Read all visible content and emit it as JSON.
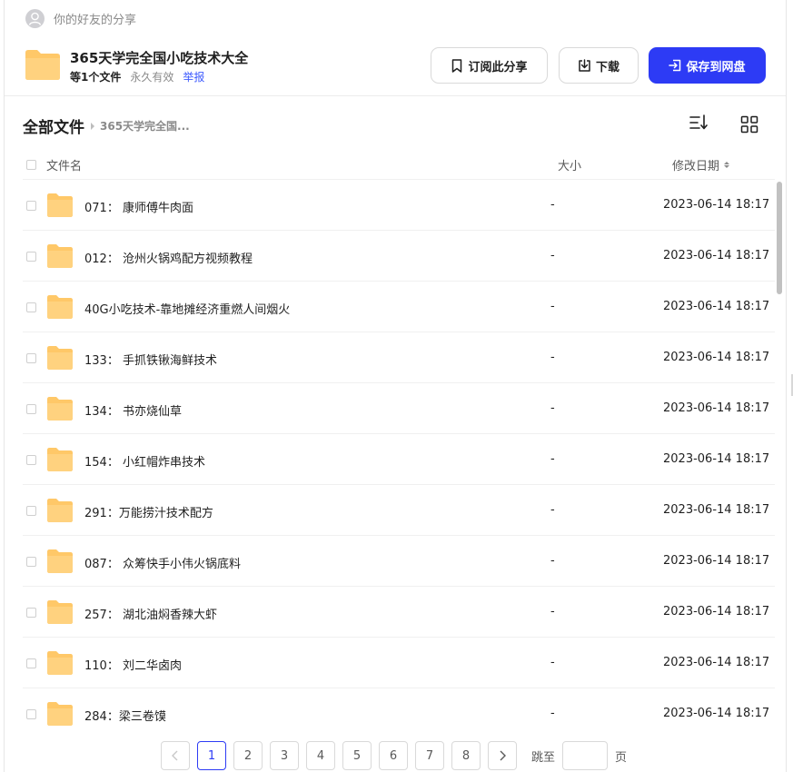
{
  "sharer": {
    "text": "你的好友的分享",
    "avatar_icon": "user-icon"
  },
  "share": {
    "title": "365天学完全国小吃技术大全",
    "file_count": "等1个文件",
    "validity": "永久有效",
    "report": "举报",
    "folder_icon": "folder-icon"
  },
  "actions": {
    "subscribe": {
      "label": "订阅此分享",
      "icon": "bookmark-icon"
    },
    "download": {
      "label": "下载",
      "icon": "download-icon"
    },
    "save": {
      "label": "保存到网盘",
      "icon": "save-icon"
    }
  },
  "breadcrumb": {
    "root": "全部文件",
    "current": "365天学完全国..."
  },
  "table": {
    "headers": {
      "name": "文件名",
      "size": "大小",
      "date": "修改日期"
    },
    "rows": [
      {
        "name": "071： 康师傅牛肉面",
        "size": "-",
        "date": "2023-06-14 18:17"
      },
      {
        "name": "012： 沧州火锅鸡配方视频教程",
        "size": "-",
        "date": "2023-06-14 18:17"
      },
      {
        "name": "40G小吃技术-靠地摊经济重燃人间烟火",
        "size": "-",
        "date": "2023-06-14 18:17"
      },
      {
        "name": "133： 手抓铁锹海鲜技术",
        "size": "-",
        "date": "2023-06-14 18:17"
      },
      {
        "name": "134： 书亦烧仙草",
        "size": "-",
        "date": "2023-06-14 18:17"
      },
      {
        "name": "154： 小红帽炸串技术",
        "size": "-",
        "date": "2023-06-14 18:17"
      },
      {
        "name": "291：万能捞汁技术配方",
        "size": "-",
        "date": "2023-06-14 18:17"
      },
      {
        "name": "087： 众筹快手小伟火锅底料",
        "size": "-",
        "date": "2023-06-14 18:17"
      },
      {
        "name": "257： 湖北油焖香辣大虾",
        "size": "-",
        "date": "2023-06-14 18:17"
      },
      {
        "name": "110： 刘二华卤肉",
        "size": "-",
        "date": "2023-06-14 18:17"
      },
      {
        "name": "284：梁三卷馍",
        "size": "-",
        "date": "2023-06-14 18:17"
      }
    ]
  },
  "pagination": {
    "prev_icon": "chevron-left-icon",
    "next_icon": "chevron-right-icon",
    "pages": [
      "1",
      "2",
      "3",
      "4",
      "5",
      "6",
      "7",
      "8"
    ],
    "current": "1",
    "jump_label": "跳至",
    "jump_unit": "页"
  },
  "colors": {
    "primary": "#2d3bf5",
    "link": "#3d5afe",
    "folder": "#ffc868",
    "text": "#1f1f1f",
    "muted": "#8a8a8a"
  }
}
